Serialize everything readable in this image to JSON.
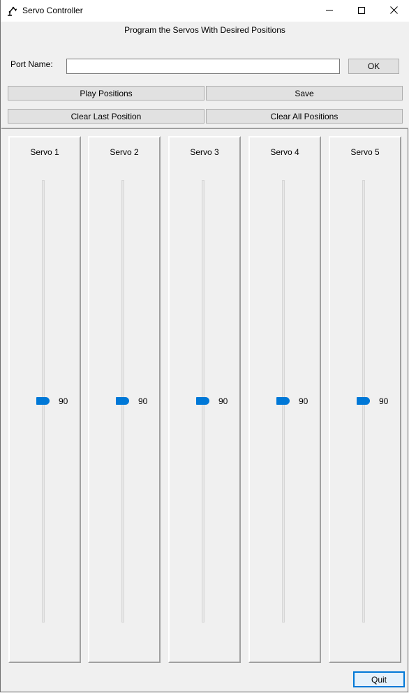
{
  "window": {
    "title": "Servo Controller",
    "app_icon": "robot-arm-icon",
    "controls": [
      "minimize-icon",
      "maximize-icon",
      "close-icon"
    ]
  },
  "header": {
    "heading": "Program the Servos With Desired Positions"
  },
  "port": {
    "label": "Port Name:",
    "value": "",
    "ok_label": "OK"
  },
  "actions": {
    "play_label": "Play Positions",
    "save_label": "Save",
    "clear_last_label": "Clear Last Position",
    "clear_all_label": "Clear All Positions"
  },
  "servos": [
    {
      "label": "Servo 1",
      "value": "90"
    },
    {
      "label": "Servo 2",
      "value": "90"
    },
    {
      "label": "Servo 3",
      "value": "90"
    },
    {
      "label": "Servo 4",
      "value": "90"
    },
    {
      "label": "Servo 5",
      "value": "90"
    }
  ],
  "footer": {
    "quit_label": "Quit"
  },
  "colors": {
    "accent": "#0078d7",
    "window_bg": "#f0f0f0",
    "button_bg": "#e1e1e1"
  }
}
